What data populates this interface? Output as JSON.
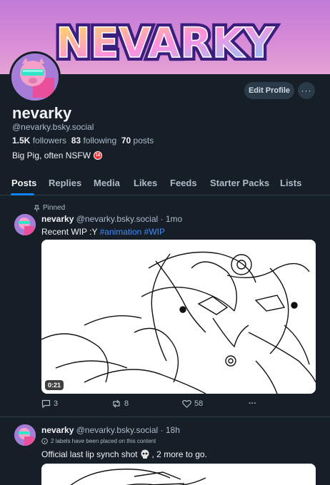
{
  "banner": {
    "logo_text": "NEVARKY"
  },
  "profile": {
    "display_name": "nevarky",
    "handle": "@nevarky.bsky.social",
    "followers_count": "1.5K",
    "followers_label": "followers",
    "following_count": "83",
    "following_label": "following",
    "posts_count": "70",
    "posts_label": "posts",
    "bio": "Big Pig, often NSFW",
    "nsfw_badge": "18",
    "edit_button": "Edit Profile",
    "more_button": "···"
  },
  "tabs": [
    {
      "label": "Posts",
      "active": true
    },
    {
      "label": "Replies",
      "active": false
    },
    {
      "label": "Media",
      "active": false
    },
    {
      "label": "Likes",
      "active": false
    },
    {
      "label": "Feeds",
      "active": false
    },
    {
      "label": "Starter Packs",
      "active": false
    },
    {
      "label": "Lists",
      "active": false
    }
  ],
  "posts": [
    {
      "pinned_label": "Pinned",
      "author": "nevarky",
      "handle": "@nevarky.bsky.social",
      "time": "· 1mo",
      "text": "Recent WIP :Y",
      "tags": [
        "#animation",
        "#WIP"
      ],
      "video_duration": "0:21",
      "replies": "3",
      "reposts": "8",
      "likes": "58",
      "more": "···"
    },
    {
      "author": "nevarky",
      "handle": "@nevarky.bsky.social",
      "time": "· 18h",
      "labels_notice": "2 labels have been placed on this content",
      "text_before": "Official last lip synch shot",
      "text_after": ", 2 more to go."
    }
  ],
  "colors": {
    "background": "#161e27",
    "accent": "#1083fe",
    "tag": "#3b8cff",
    "muted": "#aebbc9"
  }
}
